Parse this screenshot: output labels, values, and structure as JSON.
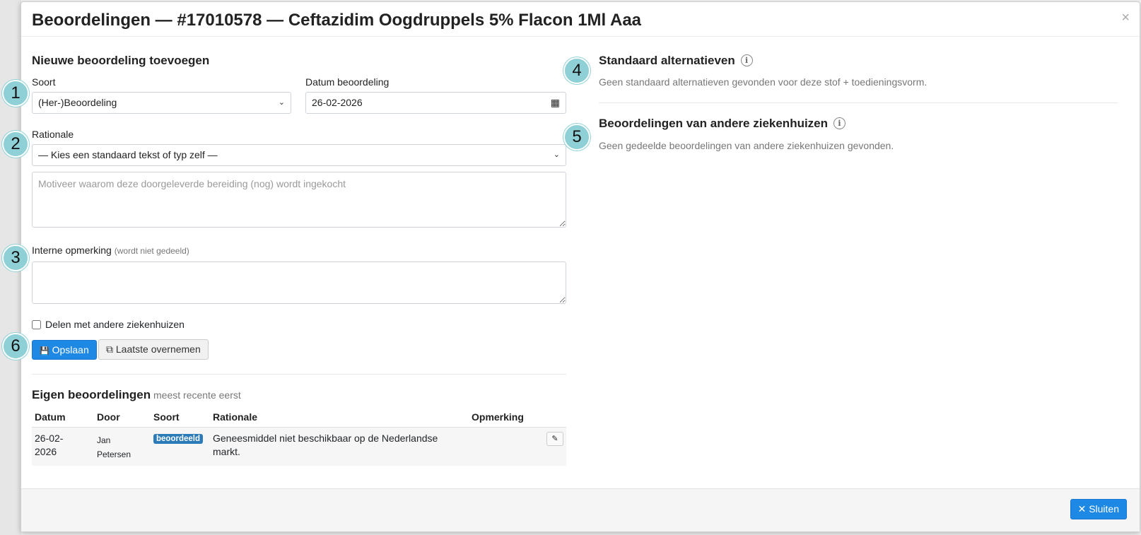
{
  "modal": {
    "title": "Beoordelingen — #17010578 — Ceftazidim Oogdruppels 5% Flacon 1Ml Aaa",
    "close_icon": "×"
  },
  "form": {
    "section_title": "Nieuwe beoordeling toevoegen",
    "soort_label": "Soort",
    "soort_value": "(Her-)Beoordeling",
    "datum_label": "Datum beoordeling",
    "datum_value": "26-02-2026",
    "rationale_label": "Rationale",
    "rationale_select_value": "— Kies een standaard tekst of typ zelf —",
    "rationale_placeholder": "Motiveer waarom deze doorgeleverde bereiding (nog) wordt ingekocht",
    "opmerking_label": "Interne opmerking",
    "opmerking_hint": "(wordt niet gedeeld)",
    "delen_label": "Delen met andere ziekenhuizen",
    "save_label": "Opslaan",
    "copy_label": "Laatste overnemen"
  },
  "markers": [
    "1",
    "2",
    "3",
    "4",
    "5",
    "6"
  ],
  "eigen": {
    "title": "Eigen beoordelingen",
    "subtitle": "meest recente eerst",
    "columns": [
      "Datum",
      "Door",
      "Soort",
      "Rationale",
      "Opmerking"
    ],
    "rows": [
      {
        "datum_line1": "26-02-",
        "datum_line2": "2026",
        "door_line1": "Jan",
        "door_line2": "Petersen",
        "soort": "beoordeeld",
        "rationale_line1": "Geneesmiddel niet beschikbaar op de Nederlandse",
        "rationale_line2": "markt.",
        "opmerking": ""
      }
    ]
  },
  "standaard": {
    "title": "Standaard alternatieven",
    "text": "Geen standaard alternatieven gevonden voor deze stof + toedieningsvorm."
  },
  "andere": {
    "title": "Beoordelingen van andere ziekenhuizen",
    "text": "Geen gedeelde beoordelingen van andere ziekenhuizen gevonden."
  },
  "footer": {
    "close_label": "Sluiten"
  },
  "icons": {
    "chevron": "⌄",
    "calendar": "▦",
    "save": "💾",
    "copy": "⧉",
    "info": "i",
    "pencil": "✎",
    "close": "✕"
  },
  "colors": {
    "primary": "#1e88e5",
    "marker": "#8fd0d6",
    "badge": "#2b7bb9"
  }
}
